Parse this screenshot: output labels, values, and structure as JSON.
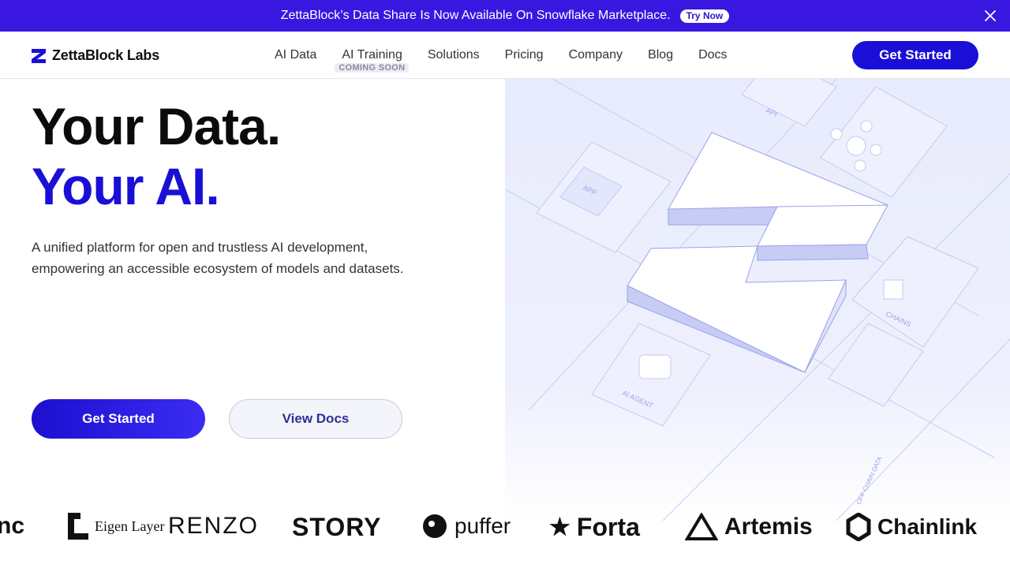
{
  "banner": {
    "text": "ZettaBlock’s Data Share Is Now Available On Snowflake Marketplace.",
    "cta": "Try Now",
    "close_icon": "close-icon"
  },
  "nav": {
    "brand": "ZettaBlock Labs",
    "items": [
      {
        "label": "AI Data"
      },
      {
        "label": "AI Training",
        "badge": "COMING SOON"
      },
      {
        "label": "Solutions"
      },
      {
        "label": "Pricing"
      },
      {
        "label": "Company"
      },
      {
        "label": "Blog"
      },
      {
        "label": "Docs"
      }
    ],
    "cta": "Get Started"
  },
  "hero": {
    "line1": "Your Data.",
    "line2": "Your AI.",
    "description": "A unified platform for open and trustless AI development, empowering an accessible ecosystem of models and datasets.",
    "primary_button": "Get Started",
    "secondary_button": "View Docs",
    "illustration_labels": [
      "API",
      "APP",
      "CHAINS",
      "AI AGENT",
      "OFF-CHAIN DATA"
    ]
  },
  "partners": [
    "nc",
    "Eigen Layer",
    "RENZO",
    "STORY",
    "puffer",
    "Forta",
    "Artemis",
    "Chainlink"
  ],
  "colors": {
    "banner": "#3a17e0",
    "brand_blue": "#1a0fd6",
    "hero_art_bg": "#e8ebfc"
  }
}
